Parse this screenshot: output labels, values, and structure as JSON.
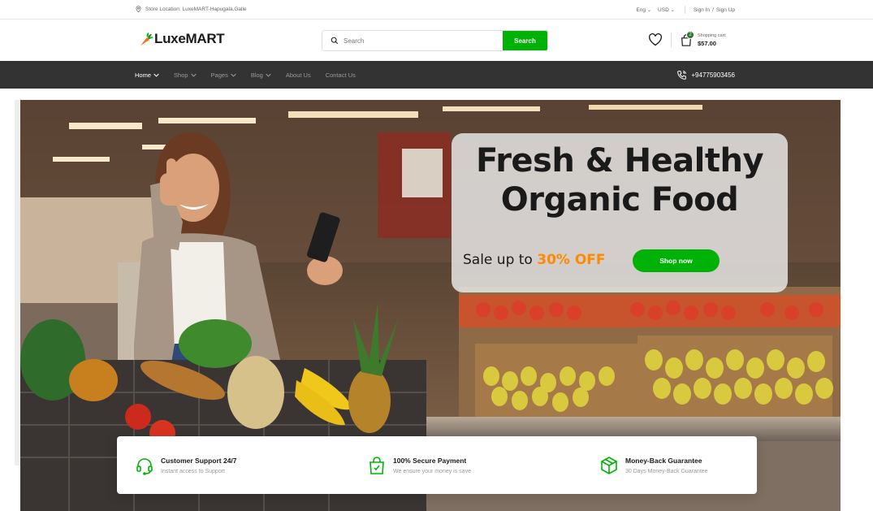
{
  "topbar": {
    "location_icon": "map-pin-icon",
    "location": "Store Location: LuxeMART-Hapugala,Galle",
    "language": "Eng",
    "currency": "USD",
    "sign_in": "Sign In",
    "divider": "/",
    "sign_up": "Sign Up"
  },
  "header": {
    "logo_text": "LuxeMART",
    "logo_icon": "carrot-icon",
    "search_placeholder": "Search",
    "search_button": "Search",
    "wishlist_icon": "heart-icon",
    "cart_icon": "shopping-bag-icon",
    "cart_count": "2",
    "cart_label": "Shopping cart:",
    "cart_total": "$57.00"
  },
  "nav": {
    "items": [
      {
        "label": "Home",
        "dropdown": true,
        "active": true
      },
      {
        "label": "Shop",
        "dropdown": true,
        "active": false
      },
      {
        "label": "Pages",
        "dropdown": true,
        "active": false
      },
      {
        "label": "Blog",
        "dropdown": true,
        "active": false
      },
      {
        "label": "About Us",
        "dropdown": false,
        "active": false
      },
      {
        "label": "Contact Us",
        "dropdown": false,
        "active": false
      }
    ],
    "phone_icon": "phone-call-icon",
    "phone": "+94775903456"
  },
  "hero": {
    "title_line1": "Fresh & Healthy",
    "title_line2": "Organic Food",
    "sale_prefix": "Sale up to",
    "sale_highlight": "30% OFF",
    "cta": "Shop now"
  },
  "features": [
    {
      "icon": "headphones-icon",
      "title": "Customer Support 24/7",
      "subtitle": "Instant access to Support"
    },
    {
      "icon": "shopping-bag-check-icon",
      "title": "100% Secure Payment",
      "subtitle": "We ensure your money is save"
    },
    {
      "icon": "package-box-icon",
      "title": "Money-Back Guarantee",
      "subtitle": "30 Days Money-Back Guarantee"
    }
  ],
  "colors": {
    "primary_green": "#00b207",
    "dark_green": "#2c742f",
    "accent_orange": "#ff8a00",
    "nav_bg": "#333333"
  }
}
